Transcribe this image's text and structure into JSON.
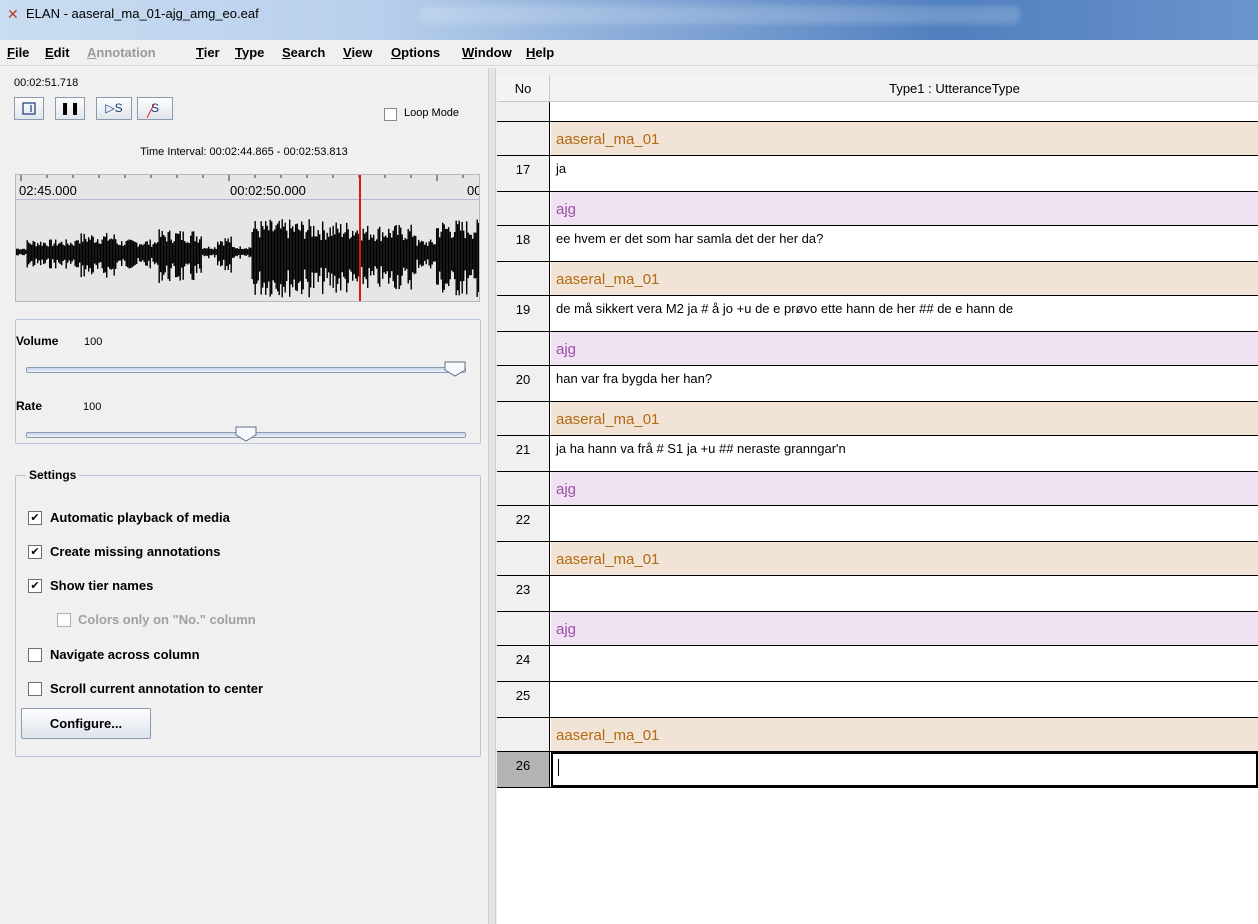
{
  "window": {
    "title": "ELAN - aaseral_ma_01-ajg_amg_eo.eaf"
  },
  "menu": [
    "File",
    "Edit",
    "Annotation",
    "Tier",
    "Type",
    "Search",
    "View",
    "Options",
    "Window",
    "Help"
  ],
  "menu_disabled": "Annotation",
  "player": {
    "time": "00:02:51.718",
    "loop_label": "Loop Mode",
    "interval": "Time Interval: 00:02:44.865 - 00:02:53.813",
    "ruler_labels": [
      "02:45.000",
      "00:02:50.000",
      "00"
    ]
  },
  "sliders": {
    "volume_label": "Volume",
    "volume_value": "100",
    "rate_label": "Rate",
    "rate_value": "100",
    "volume_level": 1.0,
    "rate_level": 0.5
  },
  "settings": {
    "legend": "Settings",
    "options": [
      {
        "label": "Automatic playback of media",
        "checked": true,
        "enabled": true
      },
      {
        "label": "Create missing annotations",
        "checked": true,
        "enabled": true
      },
      {
        "label": "Show tier names",
        "checked": true,
        "enabled": true
      },
      {
        "label": "Colors only on \"No.\" column",
        "checked": false,
        "enabled": false
      },
      {
        "label": "Navigate across column",
        "checked": false,
        "enabled": true
      },
      {
        "label": "Scroll current annotation to center",
        "checked": false,
        "enabled": true
      }
    ],
    "configure_label": "Configure..."
  },
  "table": {
    "col_no": "No",
    "col_type": "Type1 : UtteranceType",
    "rows": [
      {
        "kind": "blank",
        "no": "",
        "text": ""
      },
      {
        "kind": "tier-a",
        "no": "",
        "text": "aaseral_ma_01"
      },
      {
        "kind": "data",
        "no": "17",
        "text": "ja"
      },
      {
        "kind": "tier-b",
        "no": "",
        "text": "ajg"
      },
      {
        "kind": "data",
        "no": "18",
        "text": "ee hvem er det som har samla det der her da?"
      },
      {
        "kind": "tier-a",
        "no": "",
        "text": "aaseral_ma_01"
      },
      {
        "kind": "data",
        "no": "19",
        "text": "de må sikkert vera M2 ja # å jo +u de e prøvo ette hann de her ## de e hann de"
      },
      {
        "kind": "tier-b",
        "no": "",
        "text": "ajg"
      },
      {
        "kind": "data",
        "no": "20",
        "text": "han var fra bygda her han?"
      },
      {
        "kind": "tier-a",
        "no": "",
        "text": "aaseral_ma_01"
      },
      {
        "kind": "data",
        "no": "21",
        "text": "ja ha hann va frå # S1 ja +u ## neraste granngar'n"
      },
      {
        "kind": "tier-b",
        "no": "",
        "text": "ajg"
      },
      {
        "kind": "data",
        "no": "22",
        "text": ""
      },
      {
        "kind": "tier-a",
        "no": "",
        "text": "aaseral_ma_01"
      },
      {
        "kind": "data",
        "no": "23",
        "text": ""
      },
      {
        "kind": "tier-b",
        "no": "",
        "text": "ajg"
      },
      {
        "kind": "data",
        "no": "24",
        "text": ""
      },
      {
        "kind": "data",
        "no": "25",
        "text": ""
      },
      {
        "kind": "tier-a",
        "no": "",
        "text": "aaseral_ma_01"
      },
      {
        "kind": "current",
        "no": "26",
        "text": ""
      }
    ]
  }
}
